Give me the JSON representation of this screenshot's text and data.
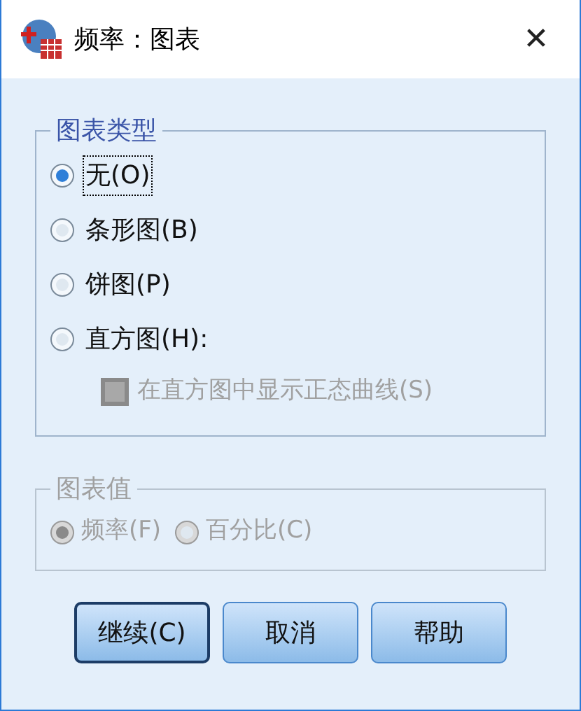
{
  "window": {
    "title": "频率：图表",
    "close": "✕"
  },
  "chart_type": {
    "legend": "图表类型",
    "options": [
      {
        "label": "无(O)",
        "selected": true,
        "focused": true
      },
      {
        "label": "条形图(B)",
        "selected": false,
        "focused": false
      },
      {
        "label": "饼图(P)",
        "selected": false,
        "focused": false
      },
      {
        "label": "直方图(H):",
        "selected": false,
        "focused": false
      }
    ],
    "normal_curve": {
      "label": "在直方图中显示正态曲线(S)",
      "checked": false,
      "disabled": true
    }
  },
  "chart_values": {
    "legend": "图表值",
    "disabled": true,
    "options": [
      {
        "label": "频率(F)",
        "selected": true
      },
      {
        "label": "百分比(C)",
        "selected": false
      }
    ]
  },
  "buttons": [
    {
      "label": "继续(C)",
      "default": true
    },
    {
      "label": "取消",
      "default": false
    },
    {
      "label": "帮助",
      "default": false
    }
  ]
}
